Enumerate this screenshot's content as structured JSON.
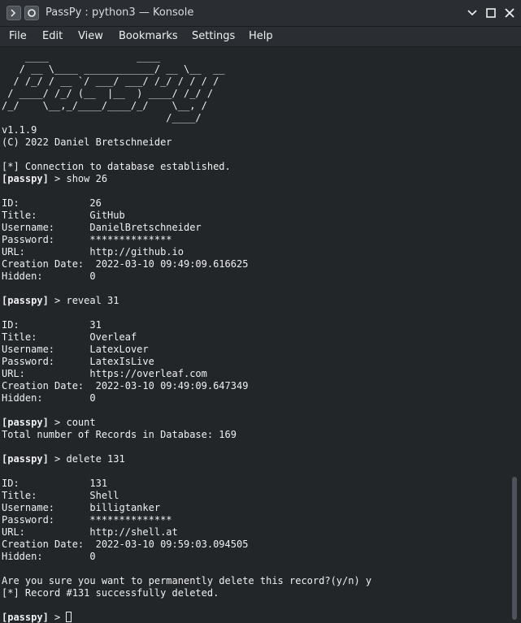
{
  "window": {
    "title": "PassPy : python3 — Konsole",
    "icons": {
      "left1": "terminal-app-icon",
      "left2": "pin-icon",
      "minimize": "chevron-down-icon",
      "maximize": "maximize-icon",
      "close": "close-icon"
    }
  },
  "menu": {
    "file": "File",
    "edit": "Edit",
    "view": "View",
    "bookmarks": "Bookmarks",
    "settings": "Settings",
    "help": "Help"
  },
  "terminal": {
    "colors": {
      "background": "#232629",
      "foreground": "#eff0f1"
    },
    "prompt": "[passpy]",
    "lines": [
      "    ____               ____",
      "   / __ \\____ ____________/ __ \\__  __",
      "  / /_/ / __ `/ ___/ ___/ /_/ / / / /",
      " / ____/ /_/ (__  |__  ) ____/ /_/ /",
      "/_/    \\__,_/____/____/_/    \\__, /",
      "                            /____/",
      "v1.1.9",
      "(C) 2022 Daniel Bretschneider",
      "",
      "[*] Connection to database established.",
      "[passpy] > show 26",
      "",
      "ID:            26",
      "Title:         GitHub",
      "Username:      DanielBretschneider",
      "Password:      **************",
      "URL:           http://github.io",
      "Creation Date:  2022-03-10 09:49:09.616625",
      "Hidden:        0",
      "",
      "[passpy] > reveal 31",
      "",
      "ID:            31",
      "Title:         Overleaf",
      "Username:      LatexLover",
      "Password:      LatexIsLive",
      "URL:           https://overleaf.com",
      "Creation Date:  2022-03-10 09:49:09.647349",
      "Hidden:        0",
      "",
      "[passpy] > count",
      "Total number of Records in Database: 169",
      "",
      "[passpy] > delete 131",
      "",
      "ID:            131",
      "Title:         Shell",
      "Username:      billigtanker",
      "Password:      **************",
      "URL:           http://shell.at",
      "Creation Date:  2022-03-10 09:59:03.094505",
      "Hidden:        0",
      "",
      "Are you sure you want to permanently delete this record?(y/n) y",
      "[*] Record #131 successfully deleted.",
      "",
      "[passpy] > "
    ],
    "cursor_after_last_line": true
  },
  "scrollbar": {
    "position_fraction": 0.84,
    "visible_fraction": 0.25
  }
}
